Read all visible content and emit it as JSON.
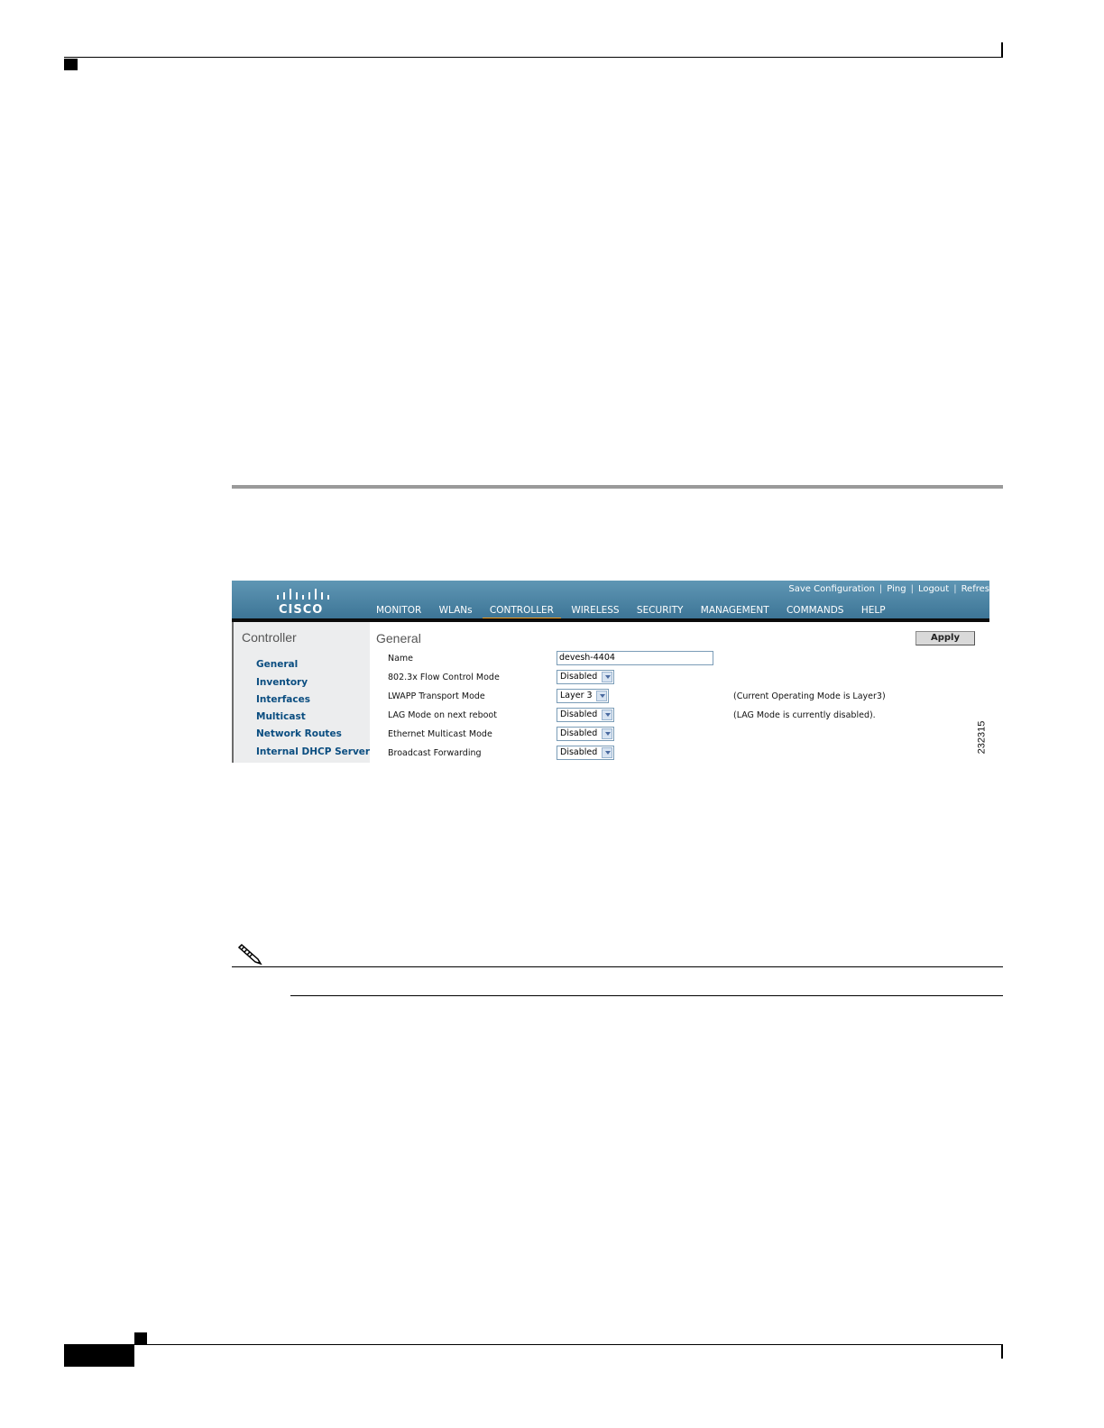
{
  "figure_id": "232315",
  "app": {
    "logo_text": "CISCO",
    "utility_links": [
      "Save Configuration",
      "Ping",
      "Logout",
      "Refres"
    ],
    "nav": [
      "MONITOR",
      "WLANs",
      "CONTROLLER",
      "WIRELESS",
      "SECURITY",
      "MANAGEMENT",
      "COMMANDS",
      "HELP"
    ],
    "active_nav": "CONTROLLER"
  },
  "sidebar": {
    "title": "Controller",
    "items": [
      "General",
      "Inventory",
      "Interfaces",
      "Multicast",
      "Network Routes",
      "Internal DHCP Server"
    ]
  },
  "main": {
    "title": "General",
    "apply_label": "Apply",
    "fields": [
      {
        "label": "Name",
        "value": "devesh-4404",
        "note": ""
      },
      {
        "label": "802.3x Flow Control Mode",
        "value": "Disabled",
        "note": ""
      },
      {
        "label": "LWAPP Transport Mode",
        "value": "Layer 3",
        "note": "(Current Operating Mode is Layer3)"
      },
      {
        "label": "LAG Mode on next reboot",
        "value": "Disabled",
        "note": "(LAG Mode is currently disabled)."
      },
      {
        "label": "Ethernet Multicast Mode",
        "value": "Disabled",
        "note": ""
      },
      {
        "label": "Broadcast Forwarding",
        "value": "Disabled",
        "note": ""
      }
    ]
  }
}
